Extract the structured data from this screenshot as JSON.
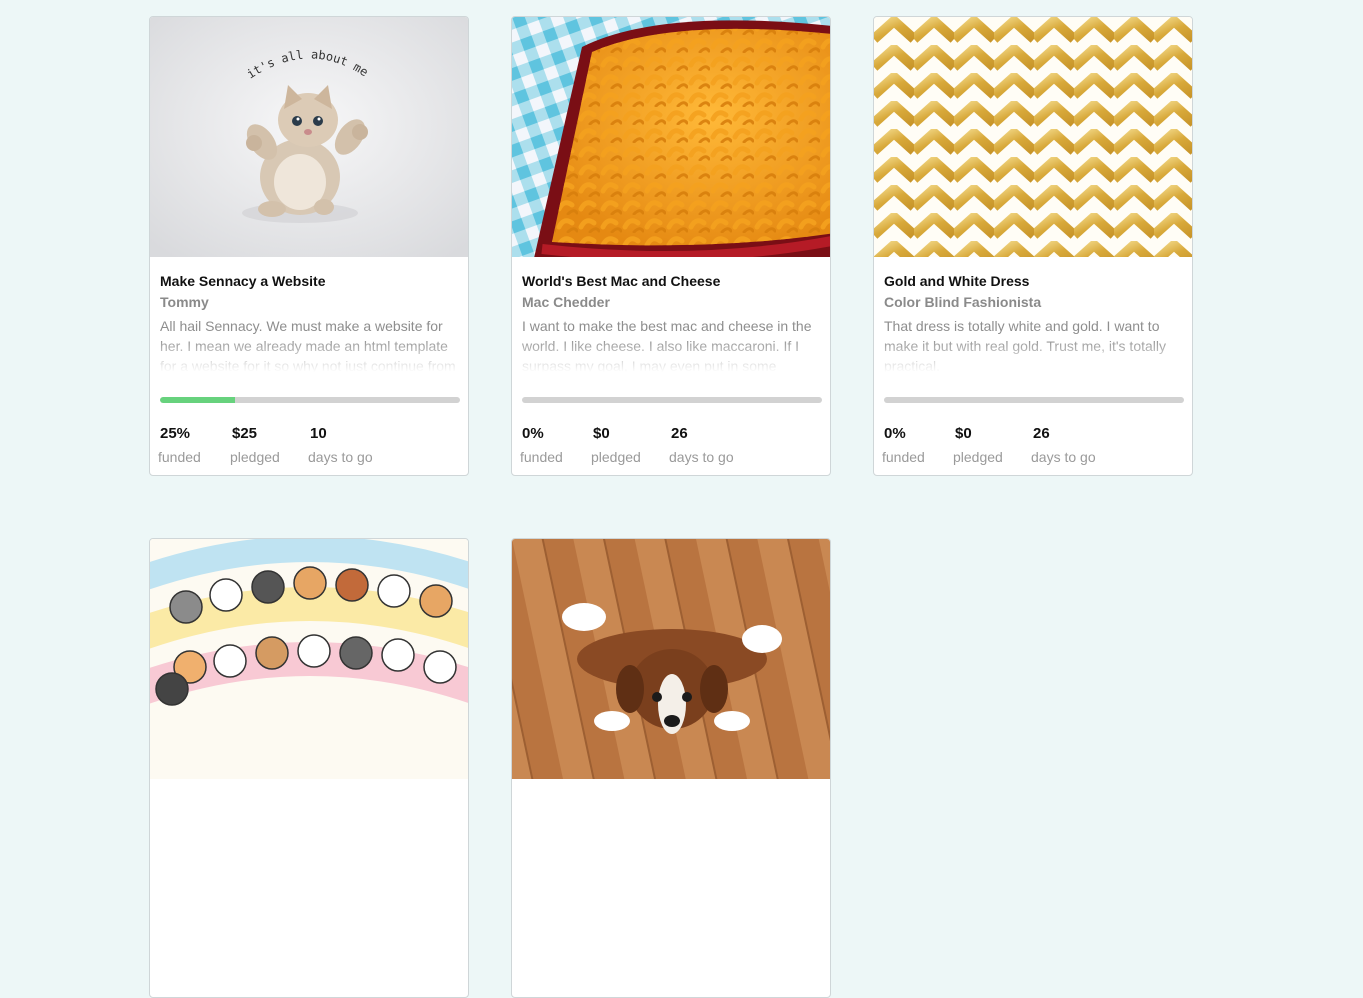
{
  "projects": [
    {
      "title": "Make Sennacy a Website",
      "creator": "Tommy",
      "blurb": "All hail Sennacy. We must make a website for her. I mean we already made an html template for a website for it so why not just continue from",
      "funded_fraction": 0.25,
      "funded": "25%",
      "funded_label": "funded",
      "pledged": "$25",
      "pledged_label": "pledged",
      "days": "10",
      "days_label": "days to go",
      "image_caption": "it's all about me",
      "image_icon": "kitten-photo"
    },
    {
      "title": "World's Best Mac and Cheese",
      "creator": "Mac Chedder",
      "blurb": "I want to make the best mac and cheese in the world. I like cheese. I also like maccaroni. If I surpass my goal, I may even put in some",
      "funded_fraction": 0,
      "funded": "0%",
      "funded_label": "funded",
      "pledged": "$0",
      "pledged_label": "pledged",
      "days": "26",
      "days_label": "days to go",
      "image_icon": "mac-and-cheese-photo"
    },
    {
      "title": "Gold and White Dress",
      "creator": "Color Blind Fashionista",
      "blurb": "That dress is totally white and gold. I want to make it but with real gold. Trust me, it's totally practical.",
      "funded_fraction": 0,
      "funded": "0%",
      "funded_label": "funded",
      "pledged": "$0",
      "pledged_label": "pledged",
      "days": "26",
      "days_label": "days to go",
      "image_icon": "gold-chevron-pattern"
    },
    {
      "image_icon": "cartoon-cats-illustration"
    },
    {
      "image_icon": "puppy-photo"
    }
  ],
  "colors": {
    "page_bg": "#edf7f7",
    "progress_fill": "#67d27d",
    "progress_track": "#d2d2d2"
  }
}
